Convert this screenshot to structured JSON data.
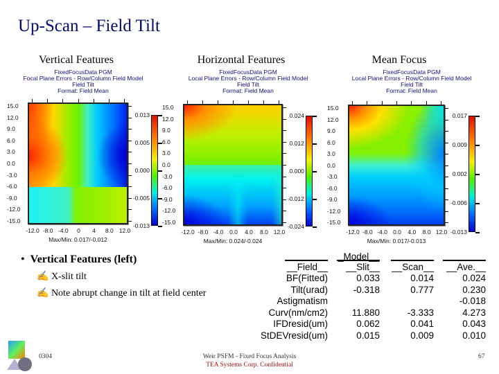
{
  "slide": {
    "title": "Up-Scan – Field Tilt",
    "page_code": "0304",
    "page_number": "67",
    "footer_line1": "Weir PSFM - Fixed Focus Analysis",
    "footer_line2": "TEA Systems Corp. Confidential"
  },
  "columns": [
    "Vertical Features",
    "Horizontal Features",
    "Mean Focus"
  ],
  "plots": [
    {
      "title_lines": [
        "FixedFocusData PGM",
        "Focal Plane Errors - Row/Column Field Model",
        "Field Tilt",
        "Format: Field Mean"
      ],
      "y_ticks": [
        "15.0",
        "12.0",
        "9.0",
        "6.0",
        "3.0",
        "0.0",
        "-3.0",
        "-6.0",
        "-9.0",
        "-12.0",
        "-15.0"
      ],
      "x_ticks": [
        "-12.0",
        "-8.0",
        "-4.0",
        "0",
        "4",
        "8.0",
        "12.0"
      ],
      "colorbar_ticks": [
        "0.013",
        "0.005",
        "0.000",
        "-0.005",
        "-0.013"
      ],
      "maxmin": "Max/Min: 0.017/-0.012"
    },
    {
      "title_lines": [
        "FixedFocusData PGM",
        "Local Plane Errors - Row/Column Field Model",
        "Field Tilt",
        "Format: Field Mean"
      ],
      "y_ticks": [
        "15.0",
        "12.0",
        "9.0",
        "6.0",
        "3.0",
        "0.0",
        "-3.0",
        "-6.0",
        "-9.0",
        "-12.0",
        "-15.0"
      ],
      "x_ticks": [
        "-12.0",
        "-8.0",
        "-4.0",
        "0.0",
        "4.0",
        "8.0",
        "12.0"
      ],
      "colorbar_ticks": [
        "0.024",
        "0.012",
        "0.000",
        "-0.012",
        "-0.024"
      ],
      "maxmin": "Max/Min: 0.024/-0.024"
    },
    {
      "title_lines": [
        "FixedFocusData PGM",
        "Local Plane Errors - Row/Column Field Model",
        "Field Tilt",
        "Format: Field Mean"
      ],
      "y_ticks": [
        "15.0",
        "12.0",
        "9.0",
        "6.0",
        "3.0",
        "0.0",
        "-3.0",
        "-6.0",
        "-9.0",
        "-12.0",
        "-15.0"
      ],
      "x_ticks": [
        "-12.0",
        "-8.0",
        "-4.0",
        "0.0",
        "4.0",
        "8.0",
        "12.0"
      ],
      "colorbar_ticks": [
        "0.017",
        "0.009",
        "0.002",
        "-0.006",
        "-0.013"
      ],
      "maxmin": "Max/Min: 0.017/-0.013"
    }
  ],
  "bullets": {
    "main": "Vertical Features (left)",
    "subs": [
      "X-slit tilt",
      "Note abrupt change in tilt at field center"
    ],
    "sub_icon": "pen-hand-icon"
  },
  "table": {
    "group_header": "_Model__",
    "headers": [
      "__Field__",
      "__Slit__",
      "__Scan__",
      "__Ave.__"
    ],
    "rows": [
      [
        "BF(Fitted)",
        "0.033",
        "0.014",
        "0.024"
      ],
      [
        "Tilt(urad)",
        "-0.318",
        "0.777",
        "0.230"
      ],
      [
        "Astigmatism",
        "",
        "",
        "-0.018"
      ],
      [
        "Curv(nm/cm2)",
        "11.880",
        "-3.333",
        "4.273"
      ],
      [
        "IFDresid(um)",
        "0.062",
        "0.041",
        "0.043"
      ],
      [
        "StDEVresid(um)",
        "0.015",
        "0.009",
        "0.010"
      ]
    ]
  }
}
